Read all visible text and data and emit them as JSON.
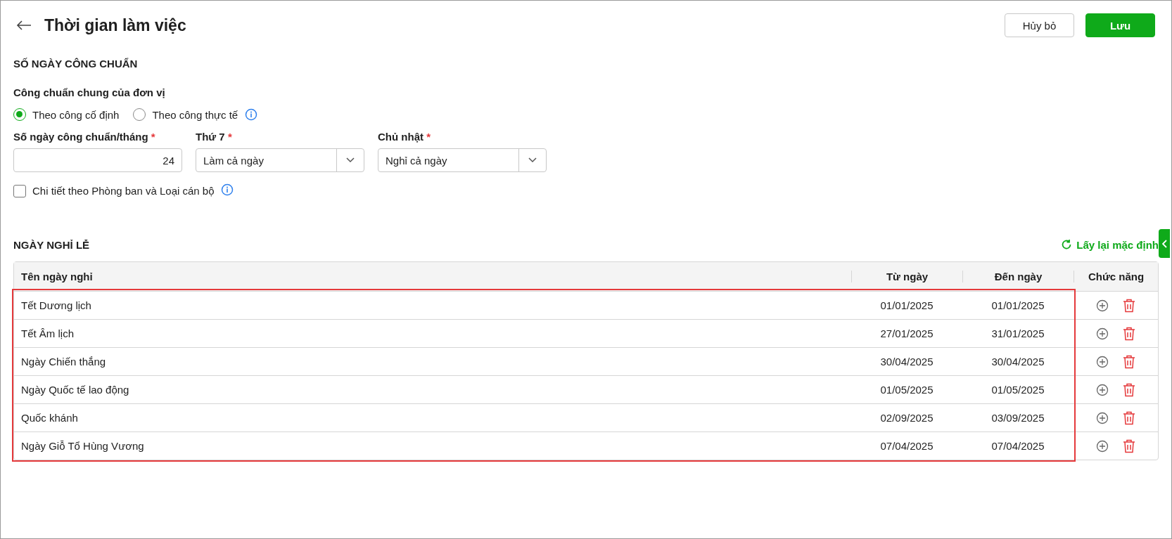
{
  "header": {
    "title": "Thời gian làm việc",
    "cancel_button": "Hủy bỏ",
    "save_button": "Lưu"
  },
  "standard_days": {
    "section_title": "SỐ NGÀY CÔNG CHUẨN",
    "group_label": "Công chuẩn chung của đơn vị",
    "radios": [
      {
        "label": "Theo công cố định",
        "selected": true
      },
      {
        "label": "Theo công thực tế",
        "selected": false
      }
    ],
    "fields": [
      {
        "kind": "number",
        "label": "Số ngày công chuẩn/tháng",
        "required_mark": "*",
        "value": "24"
      },
      {
        "kind": "select",
        "label": "Thứ 7",
        "required_mark": "*",
        "value": "Làm cả ngày"
      },
      {
        "kind": "select",
        "label": "Chủ nhật",
        "required_mark": "*",
        "value": "Nghỉ cả ngày"
      }
    ],
    "detail_checkbox": {
      "label": "Chi tiết theo Phòng ban và Loại cán bộ",
      "checked": false
    }
  },
  "holidays": {
    "section_title": "NGÀY NGHỈ LỄ",
    "reset_link": "Lấy lại mặc định",
    "rows_highlighted": true,
    "columns": [
      "Tên ngày nghỉ",
      "Từ ngày",
      "Đến ngày",
      "Chức năng"
    ],
    "rows": [
      {
        "name": "Tết Dương lịch",
        "from": "01/01/2025",
        "to": "01/01/2025"
      },
      {
        "name": "Tết Âm lịch",
        "from": "27/01/2025",
        "to": "31/01/2025"
      },
      {
        "name": "Ngày Chiến thắng",
        "from": "30/04/2025",
        "to": "30/04/2025"
      },
      {
        "name": "Ngày Quốc tế lao động",
        "from": "01/05/2025",
        "to": "01/05/2025"
      },
      {
        "name": "Quốc khánh",
        "from": "02/09/2025",
        "to": "03/09/2025"
      },
      {
        "name": "Ngày Giỗ Tổ Hùng Vương",
        "from": "07/04/2025",
        "to": "07/04/2025"
      }
    ]
  }
}
